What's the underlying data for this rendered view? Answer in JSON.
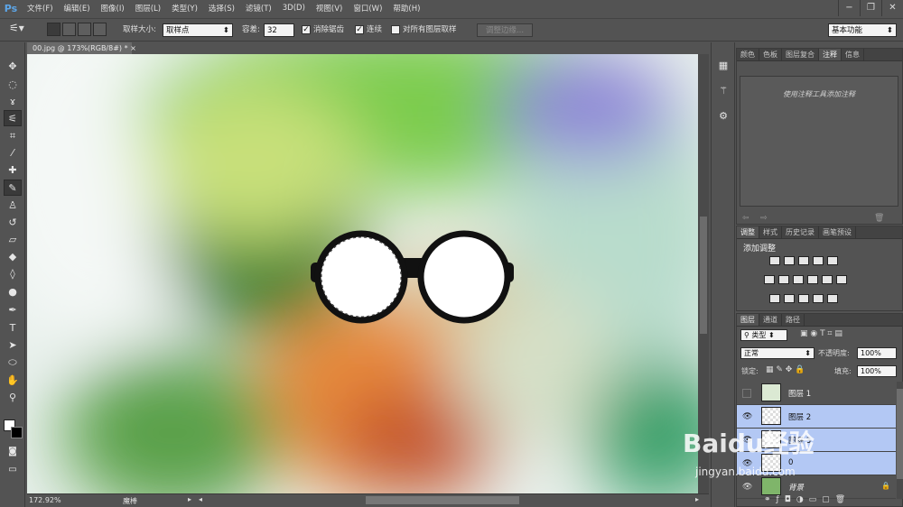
{
  "app": {
    "logo": "Ps"
  },
  "menu": [
    "文件(F)",
    "编辑(E)",
    "图像(I)",
    "图层(L)",
    "类型(Y)",
    "选择(S)",
    "滤镜(T)",
    "3D(D)",
    "视图(V)",
    "窗口(W)",
    "帮助(H)"
  ],
  "options": {
    "sample_size_label": "取样大小:",
    "sample_size_value": "取样点",
    "tolerance_label": "容差:",
    "tolerance_value": "32",
    "antialias_label": "消除锯齿",
    "contiguous_label": "连续",
    "sample_all_label": "对所有图层取样",
    "refine_edge_label": "调整边缘...",
    "workspace_value": "基本功能"
  },
  "document": {
    "tab_title": "00.jpg @ 173%(RGB/8#) *"
  },
  "status": {
    "zoom": "172.92%",
    "info": "魔棒"
  },
  "notes_panel": {
    "tabs": [
      "颜色",
      "色板",
      "图层复合",
      "注释",
      "信息"
    ],
    "active_tab": "注释",
    "placeholder": "使用注释工具添加注释"
  },
  "adjustments_panel": {
    "tabs": [
      "调整",
      "样式",
      "历史记录",
      "画笔预设"
    ],
    "title": "添加调整"
  },
  "layers_panel": {
    "tabs": [
      "图层",
      "通道",
      "路径"
    ],
    "filter_label": "类型",
    "blend_mode": "正常",
    "opacity_label": "不透明度:",
    "opacity_value": "100%",
    "lock_label": "锁定:",
    "fill_label": "填充:",
    "fill_value": "100%",
    "layers": [
      {
        "name": "图层 1",
        "visible": false,
        "selected": false
      },
      {
        "name": "图层 2",
        "visible": true,
        "selected": true
      },
      {
        "name": "图层 3",
        "visible": true,
        "selected": true
      },
      {
        "name": "0",
        "visible": true,
        "selected": true
      },
      {
        "name": "背景",
        "visible": true,
        "selected": false
      }
    ]
  },
  "watermark": {
    "brand": "Baidu经验",
    "url": "jingyan.baidu.com"
  },
  "colors": {
    "accent": "#5da6e8",
    "selection": "#b3c8f4",
    "ui_gray": "#535353"
  }
}
